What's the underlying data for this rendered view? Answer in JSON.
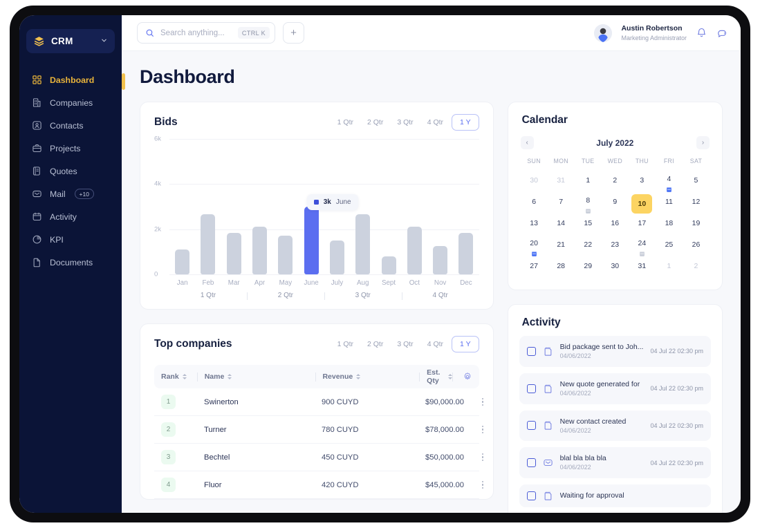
{
  "sidebar": {
    "brand": {
      "name": "CRM",
      "logo_icon": "layers-icon",
      "caret_icon": "chevron-down-icon"
    },
    "items": [
      {
        "label": "Dashboard",
        "icon": "grid-icon",
        "active": true
      },
      {
        "label": "Companies",
        "icon": "building-icon",
        "active": false
      },
      {
        "label": "Contacts",
        "icon": "contact-card-icon",
        "active": false
      },
      {
        "label": "Projects",
        "icon": "briefcase-icon",
        "active": false
      },
      {
        "label": "Quotes",
        "icon": "quote-doc-icon",
        "active": false
      },
      {
        "label": "Mail",
        "icon": "envelope-icon",
        "active": false,
        "badge": "+10"
      },
      {
        "label": "Activity",
        "icon": "calendar-icon",
        "active": false
      },
      {
        "label": "KPI",
        "icon": "pie-chart-icon",
        "active": false
      },
      {
        "label": "Documents",
        "icon": "document-icon",
        "active": false
      }
    ]
  },
  "topbar": {
    "search": {
      "placeholder": "Search anything...",
      "value": "",
      "icon": "search-icon",
      "shortcut": "CTRL K"
    },
    "add_button": "+",
    "user": {
      "name": "Austin Robertson",
      "role": "Marketing Administrator"
    },
    "bell_icon": "bell-icon",
    "chat_icon": "chat-cloud-icon"
  },
  "page": {
    "title": "Dashboard"
  },
  "bids": {
    "title": "Bids",
    "filters": [
      {
        "label": "1 Qtr",
        "active": false
      },
      {
        "label": "2 Qtr",
        "active": false
      },
      {
        "label": "3 Qtr",
        "active": false
      },
      {
        "label": "4 Qtr",
        "active": false
      },
      {
        "label": "1 Y",
        "active": true
      }
    ],
    "tooltip": {
      "value": "3k",
      "label": "June"
    }
  },
  "chart_data": {
    "type": "bar",
    "title": "Bids",
    "categories": [
      "Jan",
      "Feb",
      "Mar",
      "Apr",
      "May",
      "June",
      "July",
      "Aug",
      "Sept",
      "Oct",
      "Nov",
      "Dec"
    ],
    "values": [
      1100,
      2650,
      1850,
      2100,
      1700,
      3000,
      1500,
      2650,
      800,
      2100,
      1250,
      1850
    ],
    "highlight_index": 5,
    "highlight_color": "#5b6ef0",
    "bar_color": "#ccd2de",
    "xlabel": "",
    "ylabel": "",
    "ylim": [
      0,
      6000
    ],
    "yticks": [
      0,
      2000,
      4000,
      6000
    ],
    "ytick_labels": [
      "0",
      "2k",
      "4k",
      "6k"
    ],
    "grid": true,
    "legend": false,
    "groups": [
      "1 Qtr",
      "2 Qtr",
      "3 Qtr",
      "4 Qtr"
    ],
    "annotation": {
      "value": "3k",
      "label": "June"
    }
  },
  "companies": {
    "title": "Top companies",
    "filters": [
      {
        "label": "1 Qtr",
        "active": false
      },
      {
        "label": "2 Qtr",
        "active": false
      },
      {
        "label": "3 Qtr",
        "active": false
      },
      {
        "label": "4 Qtr",
        "active": false
      },
      {
        "label": "1 Y",
        "active": true
      }
    ],
    "columns": [
      "Rank",
      "Name",
      "Revenue",
      "Est. Qty"
    ],
    "settings_icon": "gear-icon",
    "rows": [
      {
        "rank": "1",
        "name": "Swinerton",
        "revenue": "900 CUYD",
        "qty": "$90,000.00"
      },
      {
        "rank": "2",
        "name": "Turner",
        "revenue": "780 CUYD",
        "qty": "$78,000.00"
      },
      {
        "rank": "3",
        "name": "Bechtel",
        "revenue": "450 CUYD",
        "qty": "$50,000.00"
      },
      {
        "rank": "4",
        "name": "Fluor",
        "revenue": "420 CUYD",
        "qty": "$45,000.00"
      }
    ]
  },
  "calendar": {
    "title": "Calendar",
    "month": "July 2022",
    "prev_icon": "chevron-left-icon",
    "next_icon": "chevron-right-icon",
    "dow": [
      "SUN",
      "MON",
      "TUE",
      "WED",
      "THU",
      "FRI",
      "SAT"
    ],
    "weeks": [
      [
        {
          "d": "30",
          "muted": true
        },
        {
          "d": "31",
          "muted": true
        },
        {
          "d": "1"
        },
        {
          "d": "2"
        },
        {
          "d": "3"
        },
        {
          "d": "4",
          "event": "blue"
        },
        {
          "d": "5"
        }
      ],
      [
        {
          "d": "6"
        },
        {
          "d": "7"
        },
        {
          "d": "8",
          "event": "gray"
        },
        {
          "d": "9"
        },
        {
          "d": "10",
          "selected": true
        },
        {
          "d": "11"
        },
        {
          "d": "12"
        }
      ],
      [
        {
          "d": "13"
        },
        {
          "d": "14"
        },
        {
          "d": "15"
        },
        {
          "d": "16"
        },
        {
          "d": "17"
        },
        {
          "d": "18"
        },
        {
          "d": "19"
        }
      ],
      [
        {
          "d": "20",
          "event": "blue"
        },
        {
          "d": "21"
        },
        {
          "d": "22"
        },
        {
          "d": "23"
        },
        {
          "d": "24",
          "event": "gray"
        },
        {
          "d": "25"
        },
        {
          "d": "26"
        }
      ],
      [
        {
          "d": "27"
        },
        {
          "d": "28"
        },
        {
          "d": "29"
        },
        {
          "d": "30"
        },
        {
          "d": "31"
        },
        {
          "d": "1",
          "muted": true
        },
        {
          "d": "2",
          "muted": true
        }
      ]
    ]
  },
  "activity": {
    "title": "Activity",
    "items": [
      {
        "title": "Bid package sent to Joh...",
        "date": "04/06/2022",
        "when": "04 Jul 22   02:30 pm",
        "icon": "note-icon"
      },
      {
        "title": "New quote generated for",
        "date": "04/06/2022",
        "when": "04 Jul 22   02:30 pm",
        "icon": "note-icon"
      },
      {
        "title": "New contact created",
        "date": "04/06/2022",
        "when": "04 Jul 22   02:30 pm",
        "icon": "note-icon"
      },
      {
        "title": "blal bla bla bla",
        "date": "04/06/2022",
        "when": "04 Jul 22   02:30 pm",
        "icon": "envelope-icon"
      },
      {
        "title": "Waiting for approval",
        "date": "",
        "when": "",
        "icon": "note-icon"
      }
    ]
  },
  "colors": {
    "sidebar_bg": "#0b1437",
    "accent_gold": "#e8b33a",
    "accent_blue": "#5b6ef0",
    "selected_day": "#fcd462",
    "page_bg": "#f7f8fb"
  }
}
